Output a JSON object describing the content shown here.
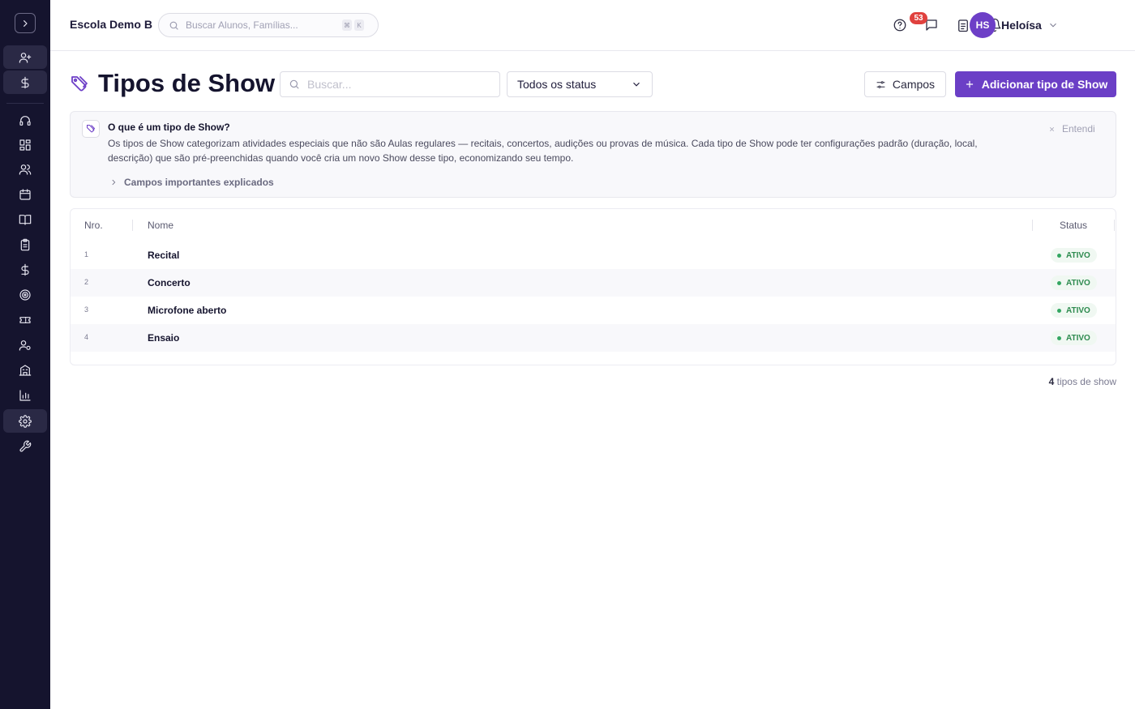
{
  "topbar": {
    "school_name": "Escola Demo B",
    "search_placeholder": "Buscar Alunos, Famílias...",
    "kbd_keys": [
      "⌘",
      "K"
    ],
    "notification_count": "53",
    "user_initials": "HS",
    "user_name": "Heloísa"
  },
  "sidebar": {
    "icons": [
      "add-user-icon",
      "dollar-icon",
      "headset-icon",
      "dashboard-icon",
      "users-icon",
      "calendar-icon",
      "book-icon",
      "clipboard-icon",
      "dollar-icon",
      "target-icon",
      "ticket-icon",
      "user-settings-icon",
      "building-icon",
      "chart-icon",
      "gear-icon",
      "wrench-icon"
    ],
    "active": "gear-icon"
  },
  "page": {
    "title": "Tipos de Show",
    "search_placeholder": "Buscar...",
    "status_filter": "Todos os status",
    "campos_label": "Campos",
    "add_label": "Adicionar tipo de Show"
  },
  "info": {
    "title": "O que é um tipo de Show?",
    "text": "Os tipos de Show categorizam atividades especiais que não são Aulas regulares — recitais, concertos, audições ou provas de música. Cada tipo de Show pode ter configurações padrão (duração, local, descrição) que são pré-preenchidas quando você cria um novo Show desse tipo, economizando seu tempo.",
    "link": "Campos importantes explicados",
    "dismiss": "Entendi"
  },
  "table": {
    "headers": {
      "num": "Nro.",
      "name": "Nome",
      "status": "Status"
    },
    "rows": [
      {
        "num": "1",
        "name": "Recital",
        "status": "ATIVO"
      },
      {
        "num": "2",
        "name": "Concerto",
        "status": "ATIVO"
      },
      {
        "num": "3",
        "name": "Microfone aberto",
        "status": "ATIVO"
      },
      {
        "num": "4",
        "name": "Ensaio",
        "status": "ATIVO"
      }
    ]
  },
  "footer": {
    "count": "4",
    "count_label": "tipos de show"
  },
  "colors": {
    "accent": "#6b3fc6",
    "sidebar": "#15142e",
    "badge": "#e0413e",
    "status_active": "#2d8a4e"
  }
}
